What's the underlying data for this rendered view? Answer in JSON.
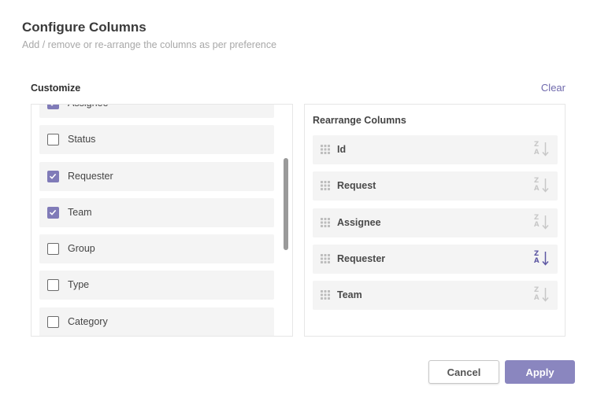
{
  "dialog": {
    "title": "Configure Columns",
    "subtitle": "Add / remove or re-arrange the columns as per preference"
  },
  "customize": {
    "label": "Customize",
    "clear_label": "Clear",
    "options": [
      {
        "label": "Assignee",
        "checked": true
      },
      {
        "label": "Status",
        "checked": false
      },
      {
        "label": "Requester",
        "checked": true
      },
      {
        "label": "Team",
        "checked": true
      },
      {
        "label": "Group",
        "checked": false
      },
      {
        "label": "Type",
        "checked": false
      },
      {
        "label": "Category",
        "checked": false
      }
    ]
  },
  "rearrange": {
    "label": "Rearrange Columns",
    "columns": [
      {
        "label": "Id",
        "sort_active": false
      },
      {
        "label": "Request",
        "sort_active": false
      },
      {
        "label": "Assignee",
        "sort_active": false
      },
      {
        "label": "Requester",
        "sort_active": true
      },
      {
        "label": "Team",
        "sort_active": false
      }
    ],
    "sort_glyph_top": "Z",
    "sort_glyph_bottom": "A",
    "sort_icon": "sort-z-to-a-icon",
    "drag_icon": "drag-handle-icon"
  },
  "footer": {
    "cancel_label": "Cancel",
    "apply_label": "Apply"
  },
  "colors": {
    "accent": "#807bb8",
    "apply_button": "#8a86bf",
    "link": "#6f69ac",
    "sort_inactive": "#c8c8c8",
    "sort_active": "#5e58a3"
  }
}
